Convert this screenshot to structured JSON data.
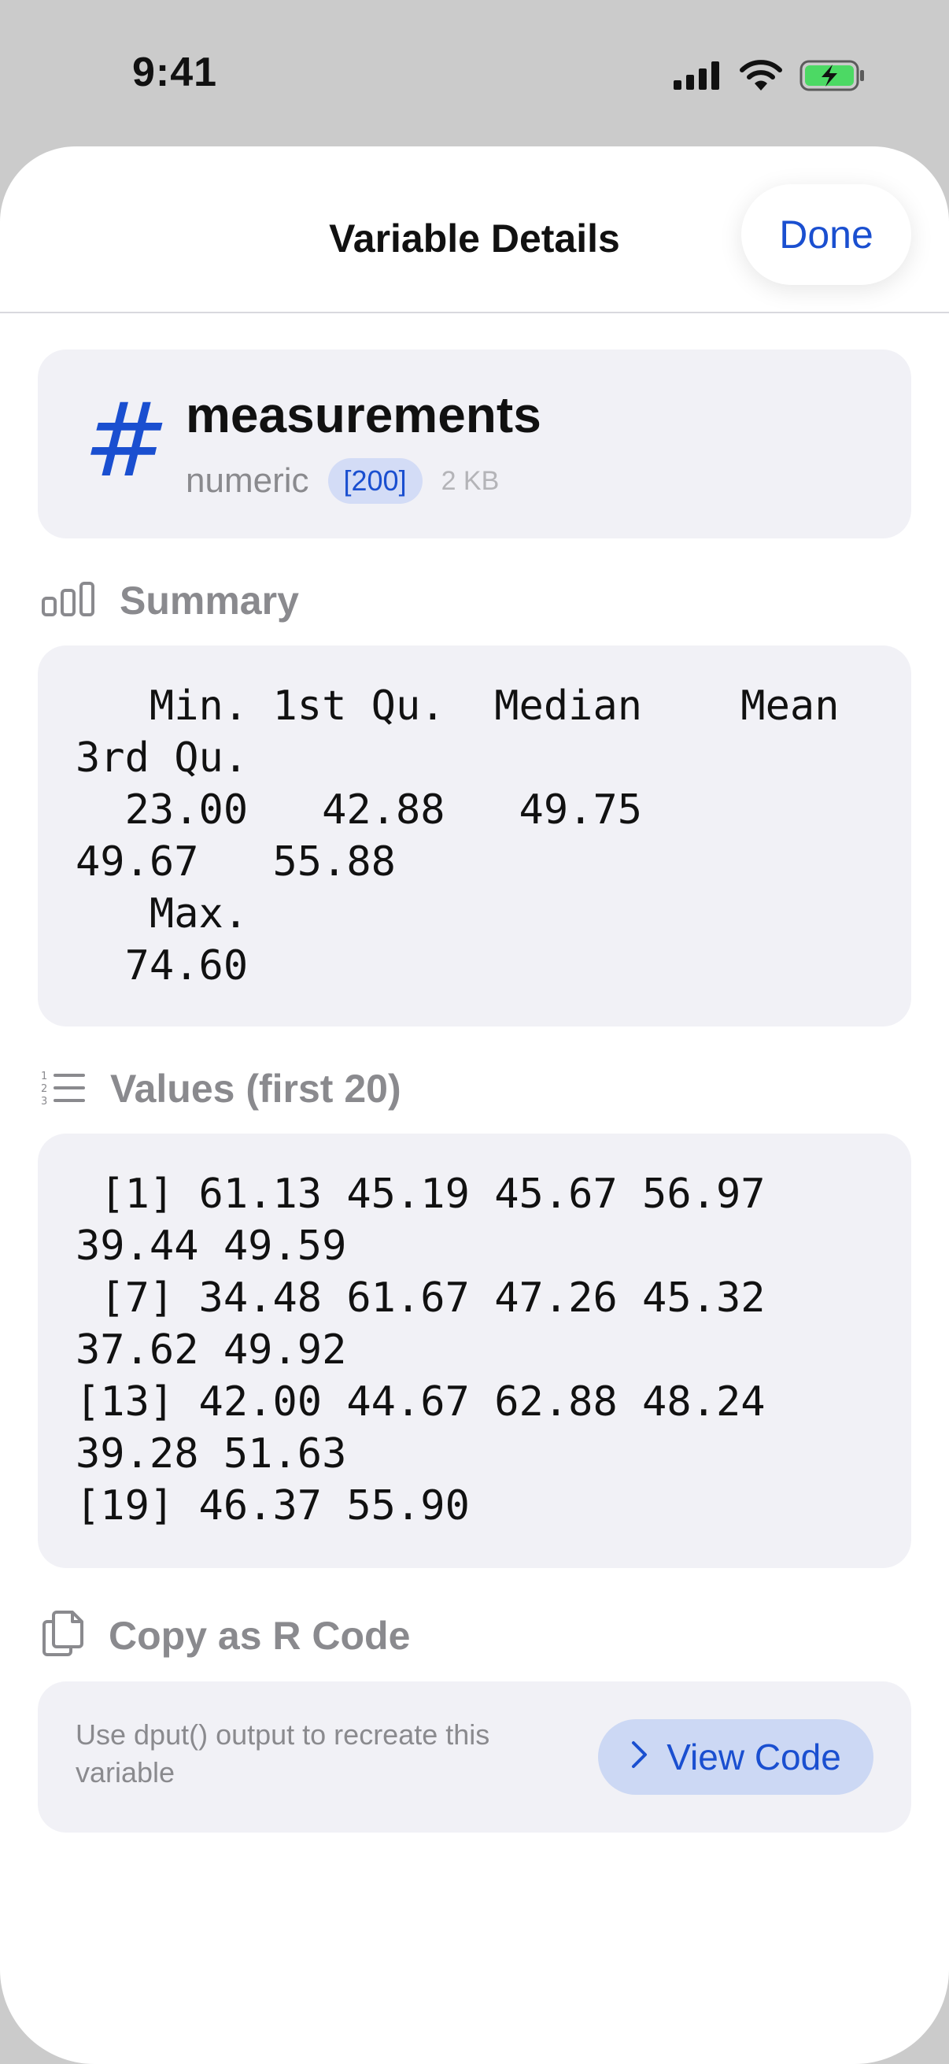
{
  "status_bar": {
    "time": "9:41"
  },
  "header": {
    "title": "Variable Details",
    "done_label": "Done"
  },
  "variable": {
    "name": "measurements",
    "type": "numeric",
    "length": "[200]",
    "size": "2 KB"
  },
  "summary": {
    "label": "Summary",
    "output": "   Min. 1st Qu.  Median    Mean\n3rd Qu.\n  23.00   42.88   49.75\n49.67   55.88\n   Max.\n  74.60"
  },
  "values": {
    "label": "Values (first 20)",
    "output": " [1] 61.13 45.19 45.67 56.97\n39.44 49.59\n [7] 34.48 61.67 47.26 45.32\n37.62 49.92\n[13] 42.00 44.67 62.88 48.24\n39.28 51.63\n[19] 46.37 55.90"
  },
  "copy": {
    "label": "Copy as R Code",
    "description": "Use dput() output to recreate this variable",
    "button_label": "View Code"
  },
  "colors": {
    "accent": "#1a4fd0",
    "card_background": "#f1f1f6",
    "secondary_text": "#8a8a8e",
    "battery_green": "#4cd964"
  },
  "icons": {
    "type_icon": "hash-icon",
    "summary_icon": "bar-chart-icon",
    "values_icon": "numbered-list-icon",
    "copy_icon": "document-copy-icon",
    "view_code_icon": "chevron-right-icon"
  }
}
